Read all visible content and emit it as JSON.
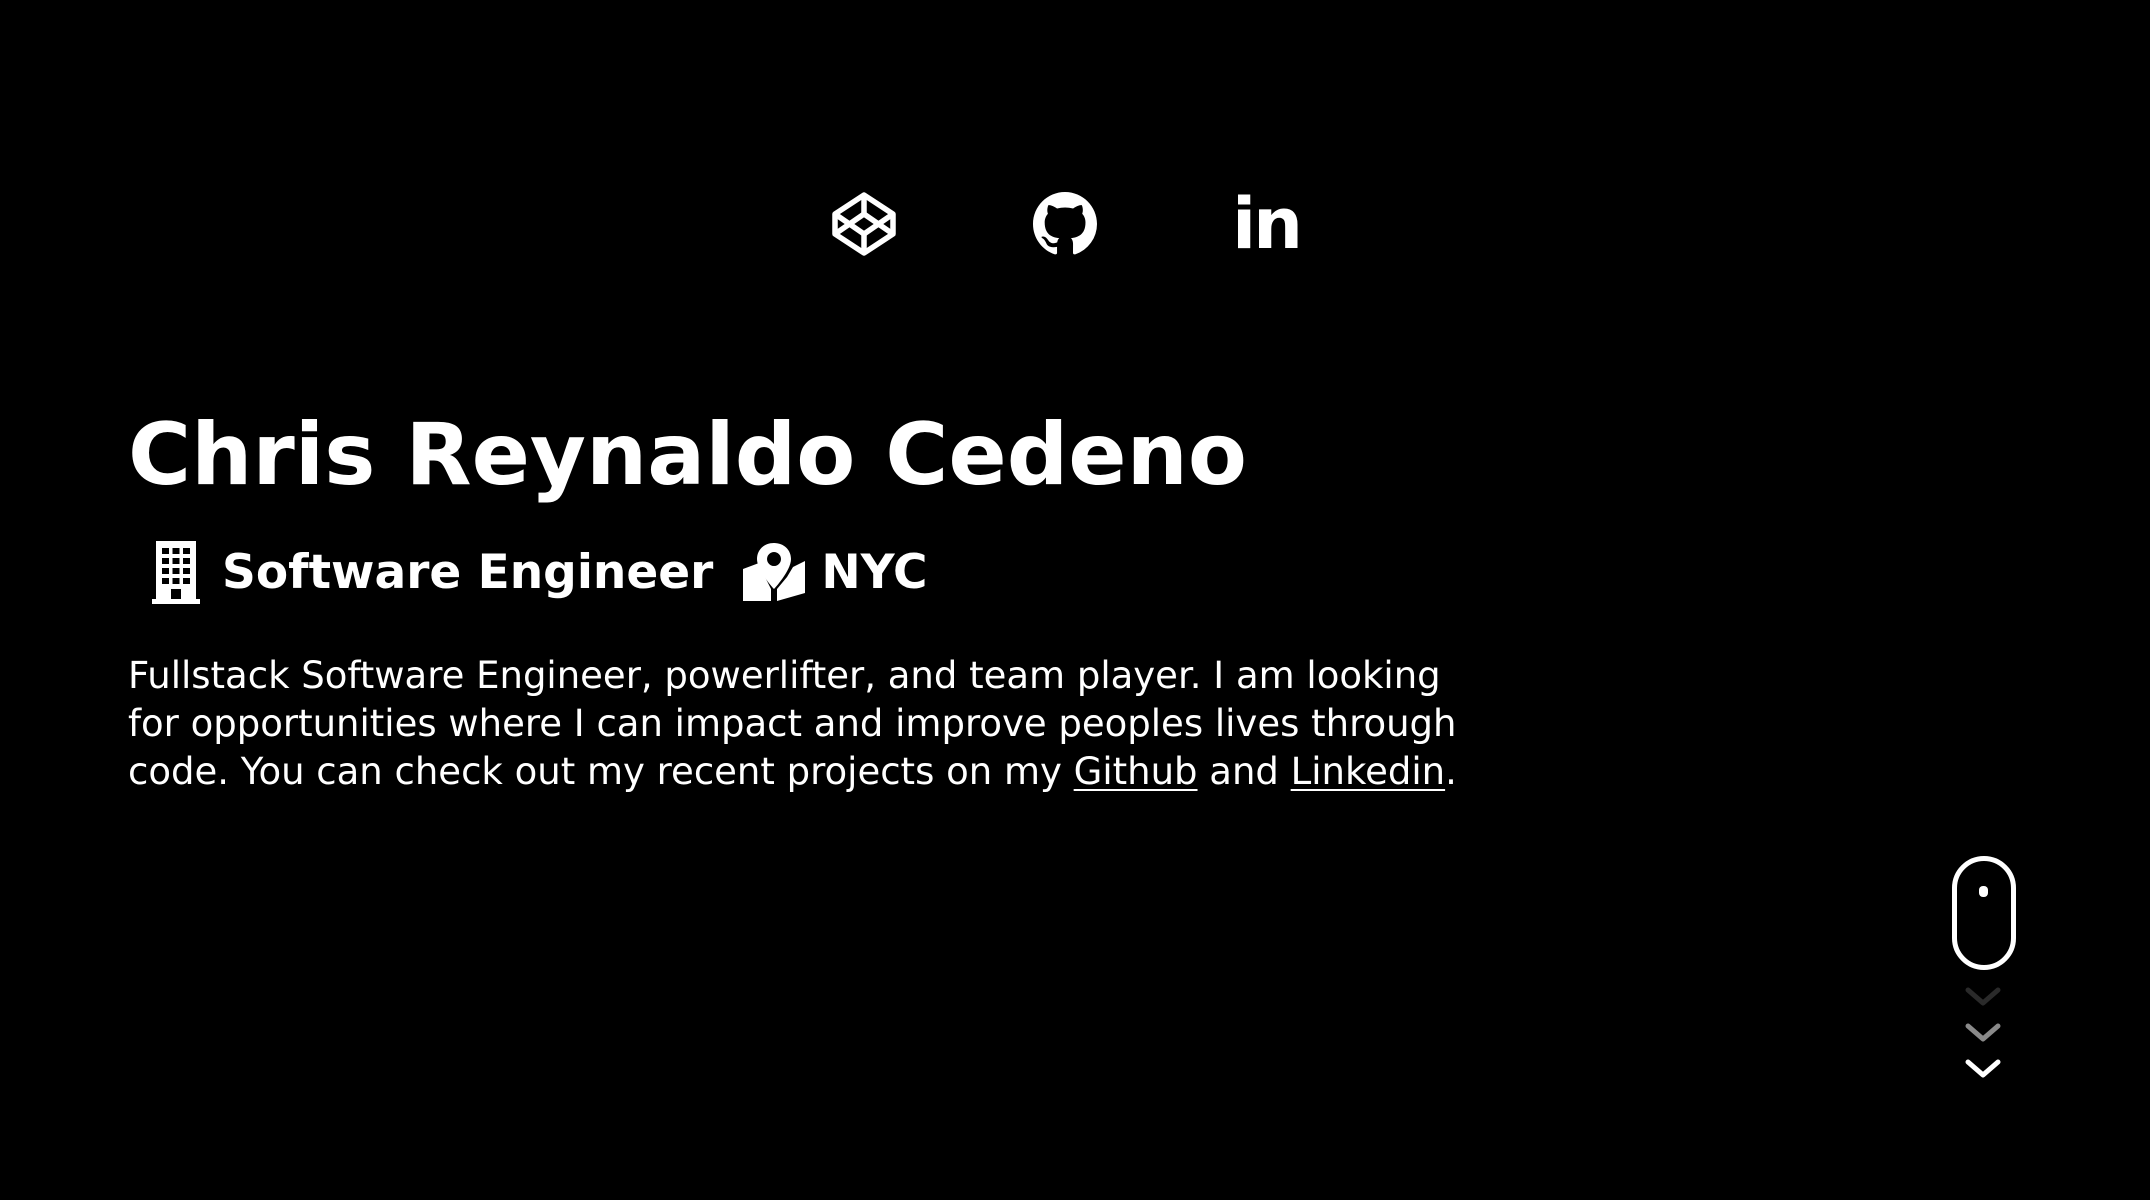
{
  "social": {
    "items": [
      {
        "name": "codepen",
        "icon": "codepen-icon"
      },
      {
        "name": "github",
        "icon": "github-icon"
      },
      {
        "name": "linkedin",
        "icon": "linkedin-icon",
        "glyph": "in"
      }
    ]
  },
  "profile": {
    "name": "Chris Reynaldo Cedeno",
    "role": "Software Engineer",
    "role_icon": "building-icon",
    "location": "NYC",
    "location_icon": "map-marker-icon",
    "bio_part1": "Fullstack Software Engineer, powerlifter, and team player. I am looking for opportunities where I can impact and improve peoples lives through code. You can check out my recent projects on my ",
    "github_link": "Github",
    "bio_and": " and ",
    "linkedin_link": "Linkedin",
    "bio_end": "."
  },
  "scroll": {
    "icon": "mouse-icon",
    "chevron_icon": "chevron-down-icon"
  },
  "colors": {
    "background": "#000000",
    "text": "#ffffff"
  }
}
